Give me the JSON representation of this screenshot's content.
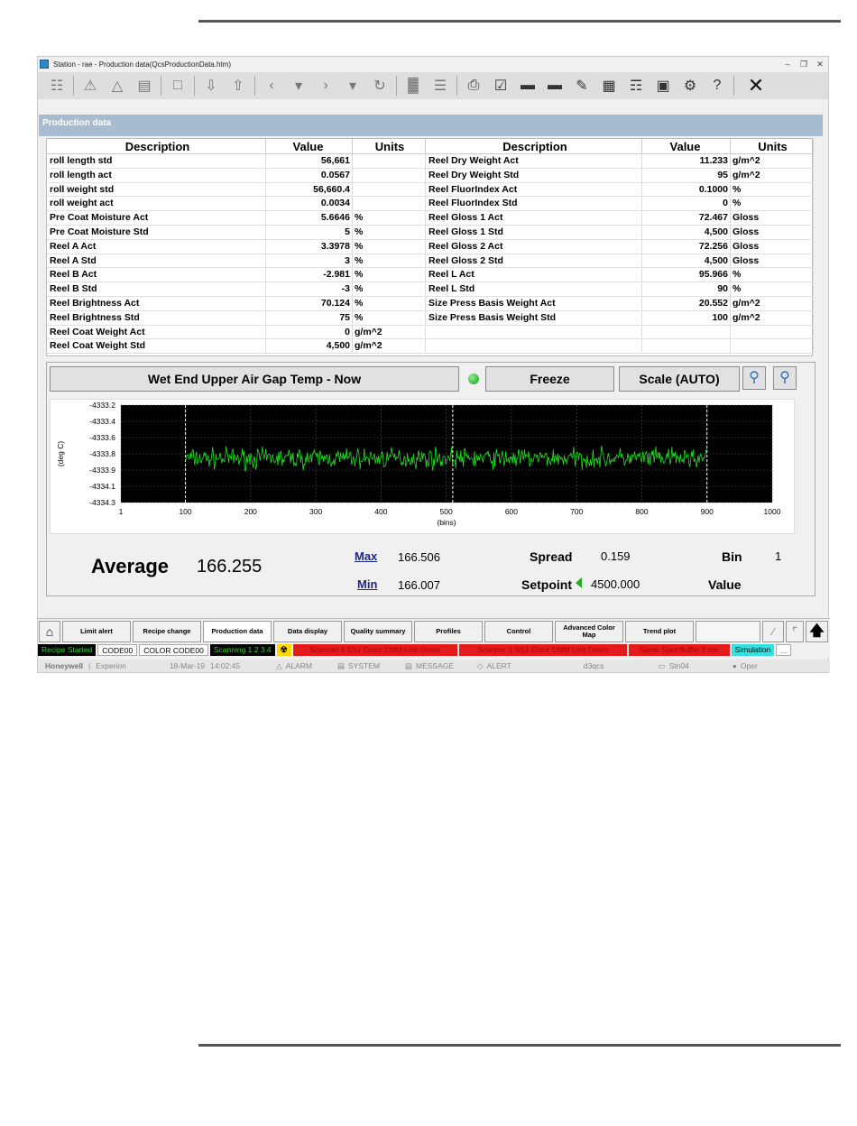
{
  "window": {
    "title": "Station - rae - Production data(QcsProductionData.htm)",
    "controls": [
      "–",
      "❐",
      "✕"
    ]
  },
  "section": {
    "title": "Production data"
  },
  "table": {
    "headers": {
      "description": "Description",
      "value": "Value",
      "units": "Units"
    },
    "left_rows": [
      {
        "description": "roll length std",
        "value": "56,661",
        "units": ""
      },
      {
        "description": "roll length act",
        "value": "0.0567",
        "units": ""
      },
      {
        "description": "roll weight std",
        "value": "56,660.4",
        "units": ""
      },
      {
        "description": "roll weight act",
        "value": "0.0034",
        "units": ""
      },
      {
        "description": "Pre Coat Moisture Act",
        "value": "5.6646",
        "units": "%"
      },
      {
        "description": "Pre Coat Moisture Std",
        "value": "5",
        "units": "%"
      },
      {
        "description": "Reel A Act",
        "value": "3.3978",
        "units": "%"
      },
      {
        "description": "Reel A Std",
        "value": "3",
        "units": "%"
      },
      {
        "description": "Reel B Act",
        "value": "-2.981",
        "units": "%"
      },
      {
        "description": "Reel B Std",
        "value": "-3",
        "units": "%"
      },
      {
        "description": "Reel Brightness Act",
        "value": "70.124",
        "units": "%"
      },
      {
        "description": "Reel Brightness Std",
        "value": "75",
        "units": "%"
      },
      {
        "description": "Reel Coat Weight Act",
        "value": "0",
        "units": "g/m^2"
      },
      {
        "description": "Reel Coat Weight Std",
        "value": "4,500",
        "units": "g/m^2"
      }
    ],
    "right_rows": [
      {
        "description": "Reel Dry Weight Act",
        "value": "11.233",
        "units": "g/m^2"
      },
      {
        "description": "Reel Dry Weight Std",
        "value": "95",
        "units": "g/m^2"
      },
      {
        "description": "Reel FluorIndex Act",
        "value": "0.1000",
        "units": "%"
      },
      {
        "description": "Reel FluorIndex Std",
        "value": "0",
        "units": "%"
      },
      {
        "description": "Reel Gloss 1 Act",
        "value": "72.467",
        "units": "Gloss"
      },
      {
        "description": "Reel Gloss 1 Std",
        "value": "4,500",
        "units": "Gloss"
      },
      {
        "description": "Reel Gloss 2 Act",
        "value": "72.256",
        "units": "Gloss"
      },
      {
        "description": "Reel Gloss 2 Std",
        "value": "4,500",
        "units": "Gloss"
      },
      {
        "description": "Reel L Act",
        "value": "95.966",
        "units": "%"
      },
      {
        "description": "Reel L Std",
        "value": "90",
        "units": "%"
      },
      {
        "description": "Size Press Basis Weight Act",
        "value": "20.552",
        "units": "g/m^2"
      },
      {
        "description": "Size Press Basis Weight Std",
        "value": "100",
        "units": "g/m^2"
      },
      {
        "description": "",
        "value": "",
        "units": ""
      },
      {
        "description": "",
        "value": "",
        "units": ""
      }
    ]
  },
  "trend": {
    "title": "Wet End Upper Air Gap Temp - Now",
    "freeze_label": "Freeze",
    "scale_label": "Scale (AUTO)"
  },
  "chart_data": {
    "type": "line",
    "ylabel": "(deg C)",
    "xlabel": "(bins)",
    "xlim": [
      1,
      1000
    ],
    "ylim": [
      -4334.3,
      -4333.2
    ],
    "x_ticks": [
      "1",
      "100",
      "200",
      "300",
      "400",
      "500",
      "600",
      "700",
      "800",
      "900",
      "1000"
    ],
    "y_ticks": [
      "-4333.2",
      "-4333.4",
      "-4333.6",
      "-4333.8",
      "-4333.9",
      "-4334.1",
      "-4334.3"
    ],
    "grid": true,
    "series": [
      {
        "x_range": [
          100,
          900
        ],
        "center": -4333.8,
        "amplitude": 0.1,
        "color": "#22e022"
      }
    ],
    "markers": [
      100,
      510,
      900
    ],
    "background": "#000000"
  },
  "stats": {
    "average_label": "Average",
    "average_value": "166.255",
    "max_label": "Max",
    "max_value": "166.506",
    "min_label": "Min",
    "min_value": "166.007",
    "spread_label": "Spread",
    "spread_value": "0.159",
    "setpoint_label": "Setpoint",
    "setpoint_value": "4500.000",
    "bin_label": "Bin",
    "bin_value": "1",
    "value_label": "Value"
  },
  "nav": {
    "items": [
      "Limit alert",
      "Recipe change",
      "Production data",
      "Data display",
      "Quality summary",
      "Profiles",
      "Control",
      "Advanced Color Map",
      "Trend plot",
      ""
    ],
    "active": "Production data"
  },
  "status": {
    "recipe": "Recipe Started",
    "code": "CODE00",
    "color_code": "COLOR CODE00",
    "scanning": "Scanning 1 2 3 4",
    "alarm1": "Scanner 4 SS1 Color CMM Link Down",
    "alarm2": "Scanner 3 SS1 Color CMM Link Down",
    "alarm3": "Same Spot Buffer Error",
    "simulation": "Simulation",
    "more": "..."
  },
  "footer": {
    "brand": "Honeywell",
    "product": "Experion",
    "date": "18-Mar-19",
    "time": "14:02:45",
    "alarm": "ALARM",
    "system": "SYSTEM",
    "message": "MESSAGE",
    "alert": "ALERT",
    "server": "d3qcs",
    "station": "Stn04",
    "user": "Oper"
  }
}
